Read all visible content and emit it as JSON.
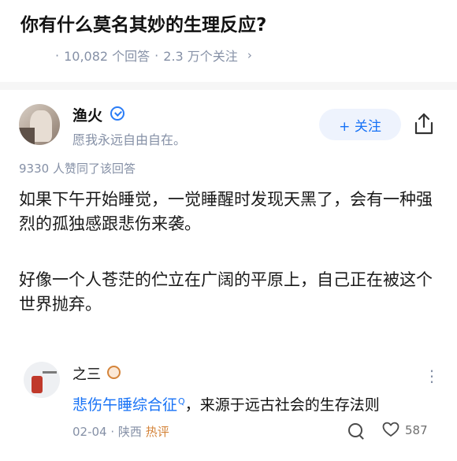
{
  "question": {
    "title": "你有什么莫名其妙的生理反应?",
    "answer_count": "10,082 个回答",
    "separator": "·",
    "follow_count": "2.3 万个关注",
    "chevron": "›"
  },
  "answer": {
    "author_name": "渔火",
    "author_bio": "愿我永远自由自在。",
    "follow_label": "+ 关注",
    "upvote_text": "9330 人赞同了该回答",
    "paragraphs": [
      "如果下午开始睡觉，一觉睡醒时发现天黑了，会有一种强烈的孤独感跟悲伤来袭。",
      "好像一个人苍茫的伫立在广阔的平原上，自己正在被这个世界抛弃。"
    ]
  },
  "comment": {
    "author_name": "之三",
    "link_text": "悲伤午睡综合征",
    "link_marker": "Q",
    "text": "，来源于远古社会的生存法则",
    "date": "02-04",
    "location": "陕西",
    "tag": "热评",
    "more": "⋮",
    "like_count": "587"
  },
  "colors": {
    "accent": "#1772f6",
    "muted": "#8590a6",
    "hot": "#d4843a"
  }
}
